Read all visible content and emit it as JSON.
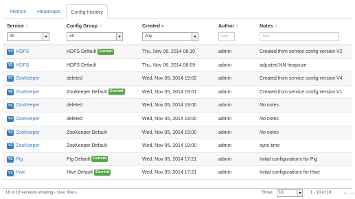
{
  "tabs": [
    "Metrics",
    "Heatmaps",
    "Config History"
  ],
  "columns": {
    "service": "Service",
    "config_group": "Config Group",
    "created": "Created",
    "author": "Author",
    "notes": "Notes"
  },
  "filters": {
    "service": "All",
    "config_group": "All",
    "created": "Any",
    "author_placeholder": "Any",
    "notes_placeholder": "Any"
  },
  "rows": [
    {
      "version": "V4",
      "service": "HDFS",
      "group": "HDFS Default",
      "current": "Current",
      "created": "Thu, Nov 06, 2014 08:10",
      "author": "admin",
      "notes": "Created from service config version V2"
    },
    {
      "version": "V3",
      "service": "HDFS",
      "group": "HDFS Default",
      "current": "",
      "created": "Thu, Nov 06, 2014 08:09",
      "author": "admin",
      "notes": "adjusted NN heapsize"
    },
    {
      "version": "V7",
      "service": "ZooKeeper",
      "group": "deleted",
      "current": "",
      "created": "Wed, Nov 05, 2014 19:02",
      "author": "admin",
      "notes": "Created from service config version V4"
    },
    {
      "version": "V6",
      "service": "ZooKeeper",
      "group": "ZooKeeper Default",
      "current": "Current",
      "created": "Wed, Nov 05, 2014 19:01",
      "author": "admin",
      "notes": "Created from service config version V1"
    },
    {
      "version": "V5",
      "service": "ZooKeeper",
      "group": "deleted",
      "current": "",
      "created": "Wed, Nov 05, 2014 19:00",
      "author": "admin",
      "notes": "No notes"
    },
    {
      "version": "V4",
      "service": "ZooKeeper",
      "group": "deleted",
      "current": "",
      "created": "Wed, Nov 05, 2014 19:00",
      "author": "admin",
      "notes": "No notes"
    },
    {
      "version": "V3",
      "service": "ZooKeeper",
      "group": "ZooKeeper Default",
      "current": "",
      "created": "Wed, Nov 05, 2014 19:00",
      "author": "admin",
      "notes": "No notes"
    },
    {
      "version": "V2",
      "service": "ZooKeeper",
      "group": "ZooKeeper Default",
      "current": "",
      "created": "Wed, Nov 05, 2014 19:00",
      "author": "admin",
      "notes": "sync time"
    },
    {
      "version": "V1",
      "service": "Pig",
      "group": "Pig Default",
      "current": "Current",
      "created": "Wed, Nov 05, 2014 17:21",
      "author": "admin",
      "notes": "Initial configurations for Pig"
    },
    {
      "version": "V1",
      "service": "Hive",
      "group": "Hive Default",
      "current": "Current",
      "created": "Wed, Nov 05, 2014 17:21",
      "author": "admin",
      "notes": "Initial configurations for Hive"
    }
  ],
  "footer": {
    "summary": "18 of 18 versions showing",
    "separator": " - ",
    "clear_filters": "clear filters",
    "show_label": "Show:",
    "page_size": "10",
    "range": "1 - 10 of 18",
    "prev_icon": "←",
    "next_icon": "→"
  },
  "colors": {
    "link": "#3a7dbf",
    "current_badge": "#5aa54a",
    "version_badge": "#3a7dbf"
  }
}
